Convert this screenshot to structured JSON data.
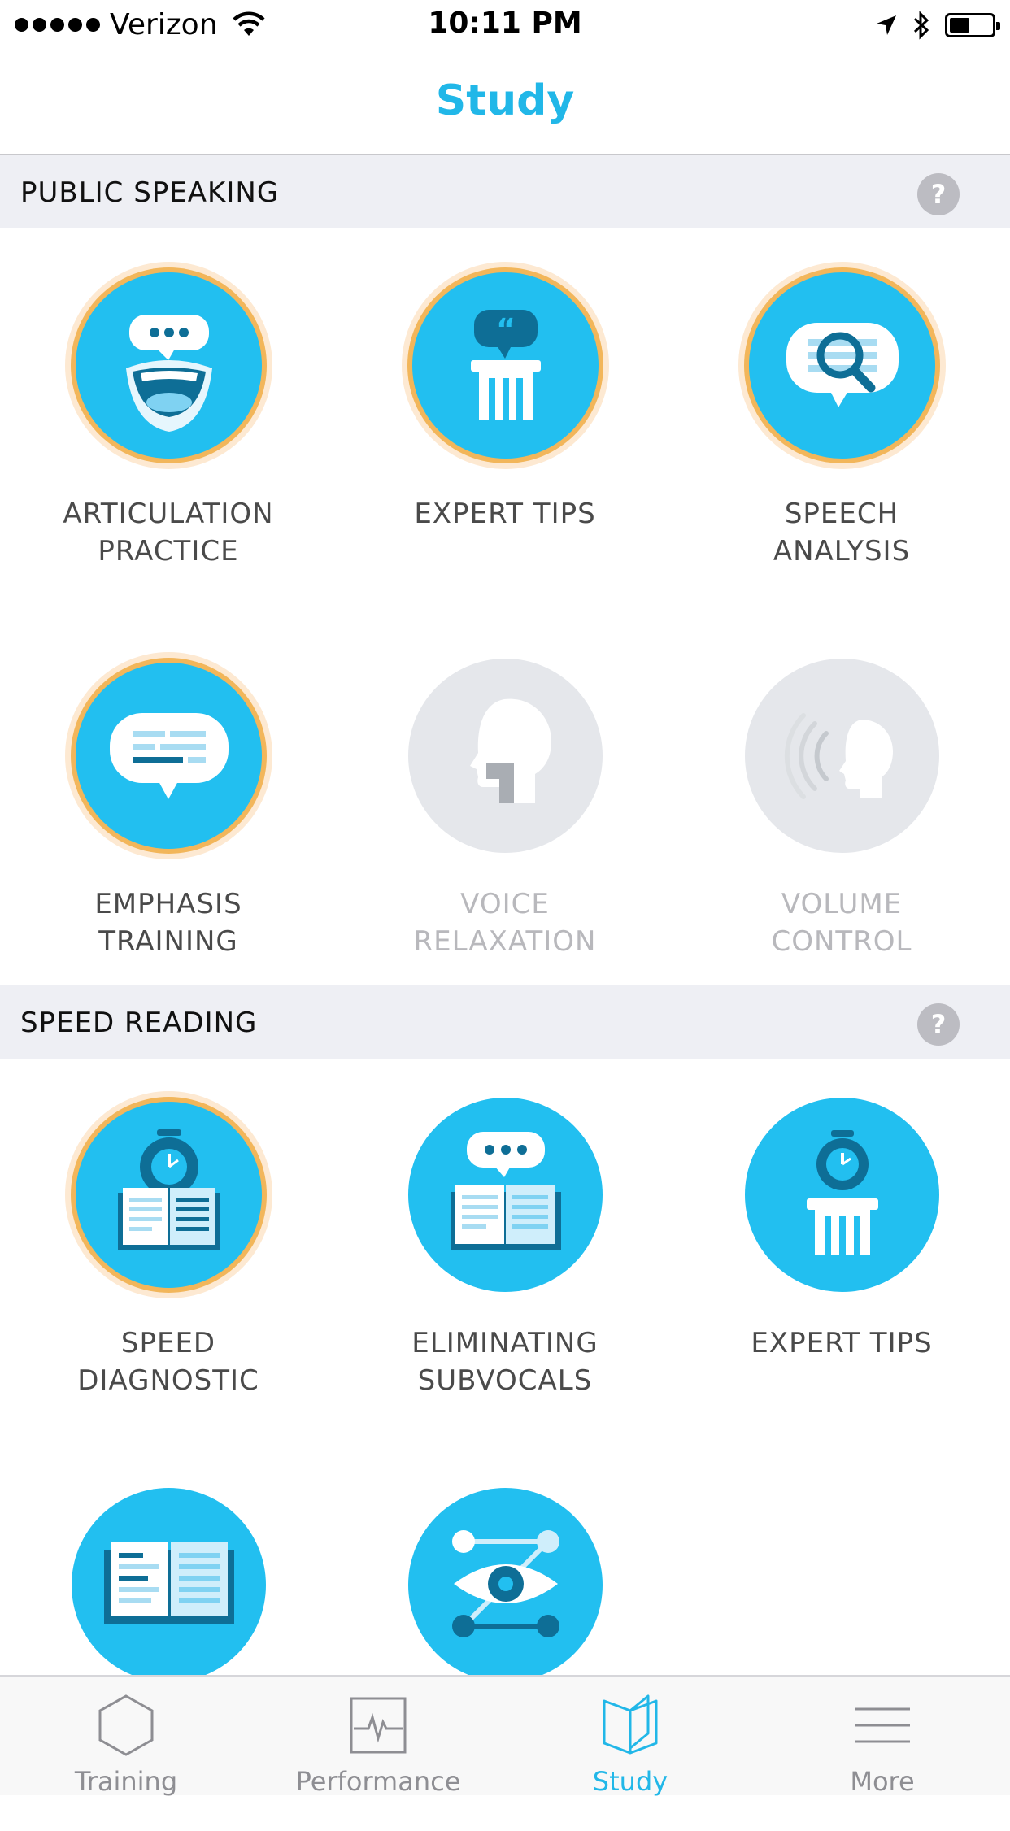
{
  "status_bar": {
    "carrier": "Verizon",
    "time": "10:11 PM",
    "signal_icon": "signal-dots-icon",
    "wifi_icon": "wifi-icon",
    "location_icon": "location-arrow-icon",
    "bluetooth_icon": "bluetooth-icon",
    "battery_icon": "battery-icon"
  },
  "nav": {
    "title": "Study"
  },
  "sections": [
    {
      "title": "PUBLIC SPEAKING",
      "help": "?",
      "items": [
        {
          "line1": "ARTICULATION",
          "line2": "PRACTICE",
          "icon": "articulation-mouth-icon",
          "state": "completed"
        },
        {
          "line1": "EXPERT TIPS",
          "line2": "",
          "icon": "expert-tips-pillar-icon",
          "state": "completed"
        },
        {
          "line1": "SPEECH",
          "line2": "ANALYSIS",
          "icon": "speech-analysis-magnifier-icon",
          "state": "completed"
        },
        {
          "line1": "EMPHASIS",
          "line2": "TRAINING",
          "icon": "emphasis-speech-bubble-icon",
          "state": "completed"
        },
        {
          "line1": "VOICE",
          "line2": "RELAXATION",
          "icon": "voice-head-throat-icon",
          "state": "locked"
        },
        {
          "line1": "VOLUME",
          "line2": "CONTROL",
          "icon": "volume-head-soundwaves-icon",
          "state": "locked"
        }
      ]
    },
    {
      "title": "SPEED READING",
      "help": "?",
      "items": [
        {
          "line1": "SPEED",
          "line2": "DIAGNOSTIC",
          "icon": "stopwatch-book-icon",
          "state": "completed"
        },
        {
          "line1": "ELIMINATING",
          "line2": "SUBVOCALS",
          "icon": "book-speech-bubble-icon",
          "state": "available"
        },
        {
          "line1": "EXPERT TIPS",
          "line2": "",
          "icon": "stopwatch-pillar-icon",
          "state": "available"
        },
        {
          "line1": "",
          "line2": "",
          "icon": "open-book-icon",
          "state": "available"
        },
        {
          "line1": "",
          "line2": "",
          "icon": "eye-path-icon",
          "state": "available"
        }
      ]
    }
  ],
  "tabs": [
    {
      "label": "Training",
      "icon": "hexagon-icon",
      "active": false
    },
    {
      "label": "Performance",
      "icon": "pulse-chart-icon",
      "active": false
    },
    {
      "label": "Study",
      "icon": "open-book-tab-icon",
      "active": true
    },
    {
      "label": "More",
      "icon": "menu-lines-icon",
      "active": false
    }
  ],
  "colors": {
    "accent": "#21b7e8",
    "icon_blue": "#22bff0",
    "dark_blue": "#0e6e96",
    "gold_ring": "#f2b65a",
    "locked_grey": "#e5e7eb",
    "section_bg": "#eeeff4"
  }
}
